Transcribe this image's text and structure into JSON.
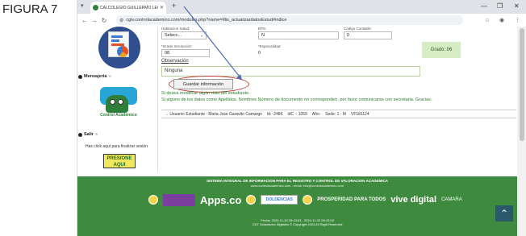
{
  "figure_label": "FIGURA 7",
  "browser": {
    "tab_title": "CALCOLEGIO GUILLERMO LEO",
    "url": "cgiv.controlacademico.com/modules.php?name=Mis_actualizardatosEstud#indice"
  },
  "form": {
    "fields": [
      {
        "label": "Habitacion Salud:",
        "value": "Selecc..."
      },
      {
        "label": "EPS:",
        "value": "N"
      },
      {
        "label": "Código Contable:",
        "value": "0"
      },
      {
        "label": "*Grado Inscripción:",
        "value": "08"
      },
      {
        "label": "*Especialidad:",
        "value": "0"
      }
    ],
    "grade_text": "Grado: 06",
    "observation_label": "Observación",
    "observation_value": "Ninguna",
    "save_button": "Guardar información",
    "info_line_1": "Si desea modificar algún dato del estudiante.",
    "info_line_2": "Si alguno de los datos como Apellidos, Nombres Número de documento no corresponden, por favor comunicarse con secretaria. Gracias.",
    "user_bar": {
      "user": "→ Usuario: Estudiante : Maria Jose Garavito Camargo",
      "id": "Id:: 2486",
      "idc": "IdC :: 1059",
      "year": "Año:",
      "sede": "Sede: 1 - M",
      "version": "VF181124"
    }
  },
  "sidebar": {
    "messages_label": "Mensajeria",
    "messages_icon_text": "Control Académico",
    "logout_label": "Salir",
    "logout_text": "Has click aquí para finalizar sesión",
    "logout_button": "PRESIONE AQUI"
  },
  "footer": {
    "title": "SISTEMA INTEGRAL DE INFORMACION PARA EL REGISTRO Y CONTROL DE VALORACION ACADEMICA",
    "web": "www.controlacademico.com - email: info@controlacademico.com",
    "apps": "Apps.co",
    "dolden": "DOLDENCIAS",
    "prosperidad": "PROSPERIDAD PARA TODOS",
    "vive": "vive",
    "digital": "digital",
    "camara": "CAMARA",
    "dates": "Fecha: 2024-11-20 09:43:03 - 2024-11-20 09:43:03",
    "copyright": "CDT Soluciones Digitales © Copyright 2024 All Right Reserved"
  }
}
